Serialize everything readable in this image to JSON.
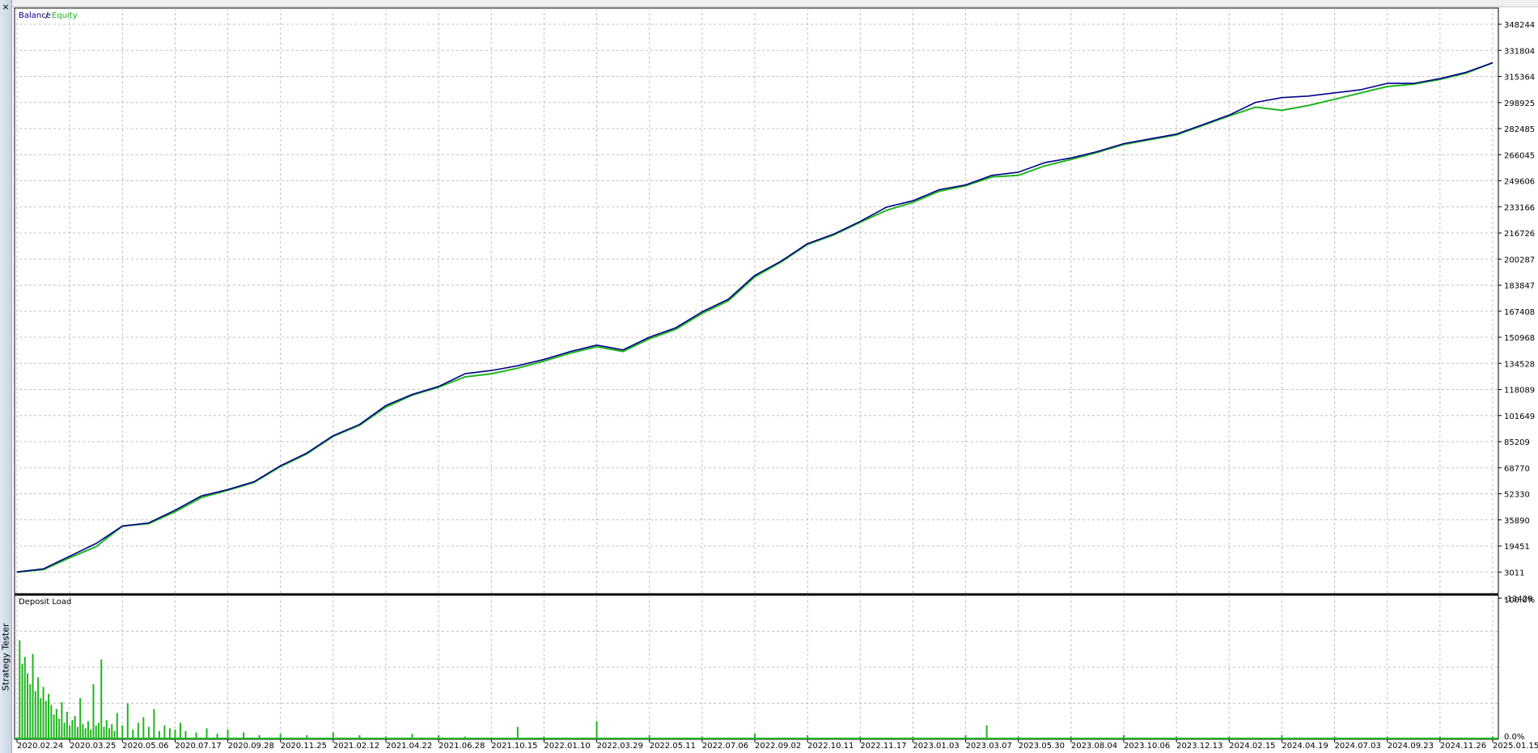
{
  "window": {
    "side_title": "Strategy Tester",
    "close_glyph": "×"
  },
  "colors": {
    "balance": "#00008b",
    "equity": "#1fb51f",
    "grid": "#c0c0c0",
    "deposit_bar": "#1fb51f"
  },
  "chart_data": [
    {
      "type": "line",
      "legend": {
        "placement": "top-left",
        "items": [
          "Balance",
          "Equity"
        ],
        "separator": " / "
      },
      "x_tick_labels": [
        "2020.02.24",
        "2020.03.25",
        "2020.05.06",
        "2020.07.17",
        "2020.09.28",
        "2020.11.25",
        "2021.02.12",
        "2021.04.22",
        "2021.06.28",
        "2021.10.15",
        "2022.01.10",
        "2022.03.29",
        "2022.05.11",
        "2022.07.06",
        "2022.09.02",
        "2022.10.11",
        "2022.11.17",
        "2023.01.03",
        "2023.03.07",
        "2023.05.30",
        "2023.08.04",
        "2023.10.06",
        "2023.12.13",
        "2024.02.15",
        "2024.04.19",
        "2024.07.03",
        "2024.09.23",
        "2024.11.26",
        "2025.01.15"
      ],
      "y_tick_labels": [
        "348244",
        "331804",
        "315364",
        "298925",
        "282485",
        "266045",
        "249606",
        "233166",
        "216726",
        "200287",
        "183847",
        "167408",
        "150968",
        "134528",
        "118089",
        "101649",
        "85209",
        "68770",
        "52330",
        "35890",
        "19451",
        "3011",
        "-13429"
      ],
      "ylim": [
        -13429,
        356000
      ],
      "grid": true,
      "series": [
        {
          "name": "Balance",
          "x": [
            0,
            0.5,
            1,
            1.5,
            2,
            2.5,
            3,
            3.5,
            4,
            4.5,
            5,
            5.5,
            6,
            6.5,
            7,
            7.5,
            8,
            8.5,
            9,
            9.5,
            10,
            10.5,
            11,
            11.5,
            12,
            12.5,
            13,
            13.5,
            14,
            14.5,
            15,
            15.5,
            16,
            16.5,
            17,
            17.5,
            18,
            18.5,
            19,
            19.5,
            20,
            20.5,
            21,
            21.5,
            22,
            22.5,
            23,
            23.5,
            24,
            24.5,
            25,
            25.5,
            26,
            26.5,
            27,
            27.5,
            28
          ],
          "values": [
            3011,
            5000,
            13000,
            21000,
            32000,
            34000,
            42000,
            51000,
            55000,
            60000,
            70000,
            78000,
            89000,
            96000,
            108000,
            115000,
            120000,
            128000,
            130000,
            133000,
            137000,
            142000,
            146000,
            143000,
            151000,
            157000,
            167000,
            175000,
            190000,
            199000,
            210000,
            216000,
            224000,
            233000,
            237000,
            244000,
            247000,
            253000,
            255000,
            261000,
            264000,
            268000,
            273000,
            276000,
            279000,
            285000,
            291000,
            299000,
            302000,
            303000,
            305000,
            307000,
            311000,
            311000,
            314000,
            318000,
            324000
          ]
        },
        {
          "name": "Equity",
          "x": [
            0,
            0.5,
            1,
            1.5,
            2,
            2.5,
            3,
            3.5,
            4,
            4.5,
            5,
            5.5,
            6,
            6.5,
            7,
            7.5,
            8,
            8.5,
            9,
            9.5,
            10,
            10.5,
            11,
            11.5,
            12,
            12.5,
            13,
            13.5,
            14,
            14.5,
            15,
            15.5,
            16,
            16.5,
            17,
            17.5,
            18,
            18.5,
            19,
            19.5,
            20,
            20.5,
            21,
            21.5,
            22,
            22.5,
            23,
            23.5,
            24,
            24.5,
            25,
            25.5,
            26,
            26.5,
            27,
            27.5,
            28
          ],
          "values": [
            3011,
            4500,
            12000,
            19000,
            32000,
            33500,
            41000,
            50000,
            54500,
            59500,
            69500,
            77500,
            88500,
            95500,
            107000,
            114500,
            119500,
            126000,
            128000,
            131500,
            136000,
            141000,
            145000,
            142000,
            150000,
            156000,
            166000,
            174000,
            189000,
            198500,
            209500,
            215500,
            223500,
            231000,
            236000,
            243000,
            246500,
            252000,
            253000,
            259000,
            263000,
            267500,
            272500,
            275500,
            278500,
            284500,
            290500,
            296000,
            294000,
            297000,
            301000,
            305000,
            309000,
            310500,
            313500,
            317500,
            324000
          ]
        }
      ]
    },
    {
      "type": "bar",
      "title": "Deposit Load",
      "y_tick_labels": [
        "100.0%",
        "0.0%"
      ],
      "ylim": [
        0,
        100
      ],
      "grid": true,
      "spikes": {
        "x": [
          0.05,
          0.1,
          0.15,
          0.2,
          0.25,
          0.3,
          0.35,
          0.4,
          0.45,
          0.5,
          0.55,
          0.6,
          0.65,
          0.7,
          0.75,
          0.8,
          0.85,
          0.9,
          0.95,
          1.0,
          1.05,
          1.1,
          1.15,
          1.2,
          1.25,
          1.3,
          1.35,
          1.4,
          1.45,
          1.5,
          1.55,
          1.6,
          1.65,
          1.7,
          1.75,
          1.8,
          1.85,
          1.9,
          2.0,
          2.1,
          2.2,
          2.3,
          2.4,
          2.5,
          2.6,
          2.7,
          2.8,
          2.9,
          3.0,
          3.1,
          3.2,
          3.4,
          3.6,
          3.8,
          4.0,
          4.3,
          4.6,
          5.0,
          5.5,
          6.0,
          6.5,
          7.0,
          7.5,
          8.0,
          8.5,
          9.5,
          10.0,
          11.0,
          12.0,
          13.0,
          14.0,
          15.0,
          16.0,
          17.0,
          18.0,
          18.4,
          19.0,
          20.0,
          21.0,
          22.0,
          23.0,
          24.0,
          25.0,
          26.0,
          27.0,
          28.0
        ],
        "values": [
          72,
          55,
          60,
          48,
          40,
          62,
          35,
          45,
          30,
          38,
          28,
          33,
          25,
          18,
          22,
          15,
          27,
          12,
          20,
          10,
          14,
          17,
          9,
          30,
          11,
          8,
          13,
          7,
          40,
          10,
          12,
          58,
          9,
          14,
          8,
          11,
          6,
          19,
          10,
          26,
          7,
          12,
          16,
          9,
          22,
          6,
          10,
          8,
          7,
          12,
          6,
          5,
          8,
          4,
          7,
          5,
          3,
          4,
          3,
          5,
          3,
          2,
          4,
          3,
          2,
          9,
          2,
          13,
          3,
          2,
          4,
          3,
          2,
          2,
          3,
          10,
          2,
          2,
          3,
          2,
          2,
          3,
          2,
          2,
          2,
          2
        ]
      }
    }
  ]
}
